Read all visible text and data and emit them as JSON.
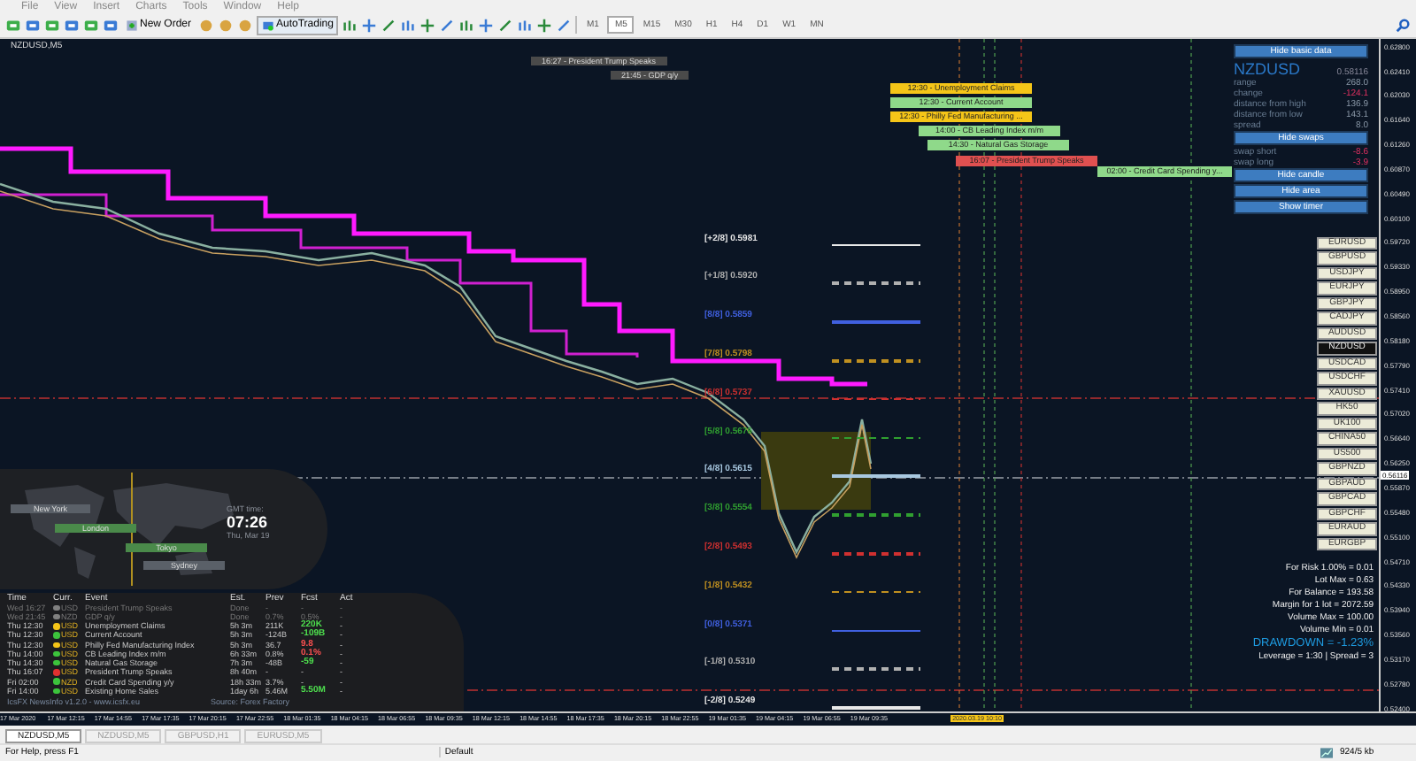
{
  "menu": [
    "File",
    "View",
    "Insert",
    "Charts",
    "Tools",
    "Window",
    "Help"
  ],
  "toolbar": {
    "new_order": "New Order",
    "auto_trading": "AutoTrading",
    "timeframes": [
      {
        "label": "M1",
        "selected": false
      },
      {
        "label": "M5",
        "selected": true
      },
      {
        "label": "M15",
        "selected": false
      },
      {
        "label": "M30",
        "selected": false
      },
      {
        "label": "H1",
        "selected": false
      },
      {
        "label": "H4",
        "selected": false
      },
      {
        "label": "D1",
        "selected": false
      },
      {
        "label": "W1",
        "selected": false
      },
      {
        "label": "MN",
        "selected": false
      }
    ]
  },
  "chart": {
    "title": "NZDUSD,M5",
    "past_events": [
      "16:27 - President Trump Speaks",
      "21:45 - GDP q/y"
    ],
    "events": [
      {
        "label": "12:30 - Unemployment Claims",
        "color": "#f5c518"
      },
      {
        "label": "12:30 - Current Account",
        "color": "#8fd98a"
      },
      {
        "label": "12:30 - Philly Fed Manufacturing ...",
        "color": "#f5c518"
      },
      {
        "label": "14:00 - CB Leading Index m/m",
        "color": "#8fd98a"
      },
      {
        "label": "14:30 - Natural Gas Storage",
        "color": "#8fd98a"
      },
      {
        "label": "16:07 - President Trump Speaks",
        "color": "#e05050"
      },
      {
        "label": "02:00 - Credit Card Spending y...",
        "color": "#8fd98a"
      }
    ],
    "fib_levels": [
      {
        "label": "[+2/8]",
        "price": "0.5981",
        "color": "#e8e8e8",
        "dashed": false
      },
      {
        "label": "[+1/8]",
        "price": "0.5920",
        "color": "#b0b0b0",
        "dashed": true
      },
      {
        "label": "[8/8]",
        "price": "0.5859",
        "color": "#4060e0",
        "dashed": false
      },
      {
        "label": "[7/8]",
        "price": "0.5798",
        "color": "#c09020",
        "dashed": true
      },
      {
        "label": "[6/8]",
        "price": "0.5737",
        "color": "#d03030",
        "dashed": true
      },
      {
        "label": "[5/8]",
        "price": "0.5676",
        "color": "#30a030",
        "dashed": true
      },
      {
        "label": "[4/8]",
        "price": "0.5615",
        "color": "#a8c8e0",
        "dashed": false
      },
      {
        "label": "[3/8]",
        "price": "0.5554",
        "color": "#30a030",
        "dashed": true
      },
      {
        "label": "[2/8]",
        "price": "0.5493",
        "color": "#d03030",
        "dashed": true
      },
      {
        "label": "[1/8]",
        "price": "0.5432",
        "color": "#c09020",
        "dashed": true
      },
      {
        "label": "[0/8]",
        "price": "0.5371",
        "color": "#4060e0",
        "dashed": false
      },
      {
        "label": "[-1/8]",
        "price": "0.5310",
        "color": "#b0b0b0",
        "dashed": true
      },
      {
        "label": "[-2/8]",
        "price": "0.5249",
        "color": "#e8e8e8",
        "dashed": false
      }
    ],
    "info_panel": {
      "hide_basic": "Hide basic data",
      "symbol": "NZDUSD",
      "price": "0.58116",
      "rows": [
        {
          "label": "range",
          "value": "268.0",
          "negative": false
        },
        {
          "label": "change",
          "value": "-124.1",
          "negative": true
        },
        {
          "label": "distance from high",
          "value": "136.9",
          "negative": false
        },
        {
          "label": "distance from low",
          "value": "143.1",
          "negative": false
        },
        {
          "label": "spread",
          "value": "8.0",
          "negative": false
        }
      ],
      "hide_swaps": "Hide swaps",
      "swaps": [
        {
          "label": "swap short",
          "value": "-8.6"
        },
        {
          "label": "swap long",
          "value": "-3.9"
        }
      ],
      "buttons": [
        "Hide candle",
        "Hide area",
        "Show timer"
      ]
    },
    "symbols": [
      {
        "label": "EURUSD",
        "selected": false
      },
      {
        "label": "GBPUSD",
        "selected": false
      },
      {
        "label": "USDJPY",
        "selected": false
      },
      {
        "label": "EURJPY",
        "selected": false
      },
      {
        "label": "GBPJPY",
        "selected": false
      },
      {
        "label": "CADJPY",
        "selected": false
      },
      {
        "label": "AUDUSD",
        "selected": false
      },
      {
        "label": "NZDUSD",
        "selected": true
      },
      {
        "label": "USDCAD",
        "selected": false
      },
      {
        "label": "USDCHF",
        "selected": false
      },
      {
        "label": "XAUUSD",
        "selected": false
      },
      {
        "label": "HK50",
        "selected": false
      },
      {
        "label": "UK100",
        "selected": false
      },
      {
        "label": "CHINA50",
        "selected": false
      },
      {
        "label": "US500",
        "selected": false
      },
      {
        "label": "GBPNZD",
        "selected": false
      },
      {
        "label": "GBPAUD",
        "selected": false
      },
      {
        "label": "GBPCAD",
        "selected": false
      },
      {
        "label": "GBPCHF",
        "selected": false
      },
      {
        "label": "EURAUD",
        "selected": false
      },
      {
        "label": "EURGBP",
        "selected": false
      }
    ],
    "risk": [
      "For Risk 1.00% = 0.01",
      "Lot Max = 0.63",
      "For Balance = 193.58",
      "Margin for 1 lot = 2072.59",
      "Volume Max = 100.00",
      "Volume Min = 0.01"
    ],
    "drawdown": "DRAWDOWN = -1.23%",
    "leverage": "Leverage = 1:30 | Spread = 3",
    "clock": {
      "sessions": [
        {
          "label": "New York",
          "active": false
        },
        {
          "label": "London",
          "active": true
        },
        {
          "label": "Tokyo",
          "active": true
        },
        {
          "label": "Sydney",
          "active": false
        }
      ],
      "caption": "GMT time:",
      "time": "07:26",
      "date": "Thu, Mar 19"
    },
    "news": {
      "columns": [
        "Time",
        "Curr.",
        "Event",
        "Est.",
        "Prev",
        "Fcst",
        "Act"
      ],
      "rows": [
        {
          "time": "Wed 16:27",
          "curr": "USD",
          "event": "President Trump Speaks",
          "est": "Done",
          "prev": "-",
          "fcst": {
            "text": "-"
          },
          "act": "-",
          "past": true,
          "color": "#808080"
        },
        {
          "time": "Wed 21:45",
          "curr": "NZD",
          "event": "GDP q/y",
          "est": "Done",
          "prev": "0.7%",
          "fcst": {
            "text": "0.5%"
          },
          "act": "-",
          "past": true,
          "color": "#808080"
        },
        {
          "time": "Thu 12:30",
          "curr": "USD",
          "event": "Unemployment Claims",
          "est": "5h 3m",
          "prev": "211K",
          "fcst": {
            "text": "220K",
            "color": "#4ee04e"
          },
          "act": "-",
          "past": false,
          "color": "#f5c518"
        },
        {
          "time": "Thu 12:30",
          "curr": "USD",
          "event": "Current Account",
          "est": "5h 3m",
          "prev": "-124B",
          "fcst": {
            "text": "-109B",
            "color": "#4ee04e"
          },
          "act": "-",
          "past": false,
          "color": "#3cc43c"
        },
        {
          "time": "Thu 12:30",
          "curr": "USD",
          "event": "Philly Fed Manufacturing Index",
          "est": "5h 3m",
          "prev": "36.7",
          "fcst": {
            "text": "9.8",
            "color": "#ff5050"
          },
          "act": "-",
          "past": false,
          "color": "#f5c518"
        },
        {
          "time": "Thu 14:00",
          "curr": "USD",
          "event": "CB Leading Index m/m",
          "est": "6h 33m",
          "prev": "0.8%",
          "fcst": {
            "text": "0.1%",
            "color": "#ff5050"
          },
          "act": "-",
          "past": false,
          "color": "#3cc43c"
        },
        {
          "time": "Thu 14:30",
          "curr": "USD",
          "event": "Natural Gas Storage",
          "est": "7h 3m",
          "prev": "-48B",
          "fcst": {
            "text": "-59",
            "color": "#4ee04e"
          },
          "act": "-",
          "past": false,
          "color": "#3cc43c"
        },
        {
          "time": "Thu 16:07",
          "curr": "USD",
          "event": "President Trump Speaks",
          "est": "8h 40m",
          "prev": "-",
          "fcst": {
            "text": "-"
          },
          "act": "-",
          "past": false,
          "color": "#e03030"
        },
        {
          "time": "Fri 02:00",
          "curr": "NZD",
          "event": "Credit Card Spending y/y",
          "est": "18h 33m",
          "prev": "3.7%",
          "fcst": {
            "text": "-"
          },
          "act": "-",
          "past": false,
          "color": "#3cc43c"
        },
        {
          "time": "Fri 14:00",
          "curr": "USD",
          "event": "Existing Home Sales",
          "est": "1day 6h",
          "prev": "5.46M",
          "fcst": {
            "text": "5.50M",
            "color": "#4ee04e"
          },
          "act": "-",
          "past": false,
          "color": "#3cc43c"
        }
      ],
      "footer": "IcsFX NewsInfo v1.2.0  -  www.icsfx.eu",
      "source": "Source: Forex Factory"
    },
    "price_axis": [
      "0.62800",
      "0.62410",
      "0.62030",
      "0.61640",
      "0.61260",
      "0.60870",
      "0.60490",
      "0.60100",
      "0.59720",
      "0.59330",
      "0.58950",
      "0.58560",
      "0.58180",
      "0.57790",
      "0.57410",
      "0.57020",
      "0.56640",
      "0.56250",
      "0.55870",
      "0.55480",
      "0.55100",
      "0.54710",
      "0.54330",
      "0.53940",
      "0.53560",
      "0.53170",
      "0.52780",
      "0.52400"
    ],
    "current_price": "0.56116",
    "time_axis": [
      "17 Mar 2020",
      "17 Mar 12:15",
      "17 Mar 14:55",
      "17 Mar 17:35",
      "17 Mar 20:15",
      "17 Mar 22:55",
      "18 Mar 01:35",
      "18 Mar 04:15",
      "18 Mar 06:55",
      "18 Mar 09:35",
      "18 Mar 12:15",
      "18 Mar 14:55",
      "18 Mar 17:35",
      "18 Mar 20:15",
      "18 Mar 22:55",
      "19 Mar 01:35",
      "19 Mar 04:15",
      "19 Mar 06:55",
      "19 Mar 09:35"
    ],
    "time_marker": "2020.03.19 10:10"
  },
  "tabs": [
    {
      "label": "NZDUSD,M5",
      "selected": true
    },
    {
      "label": "NZDUSD,M5",
      "selected": false
    },
    {
      "label": "GBPUSD,H1",
      "selected": false
    },
    {
      "label": "EURUSD,M5",
      "selected": false
    }
  ],
  "status_bar": {
    "help": "For Help, press F1",
    "profile": "Default",
    "traffic": "924/5 kb"
  }
}
